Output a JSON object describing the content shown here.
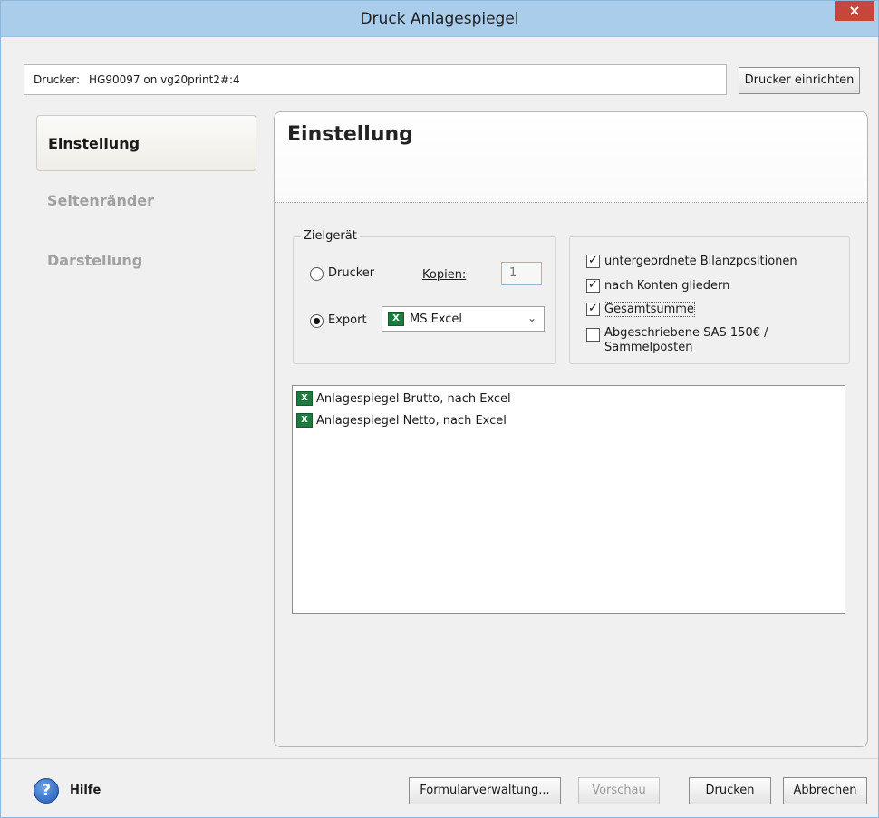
{
  "window": {
    "title": "Druck Anlagespiegel",
    "close_glyph": "×"
  },
  "printer": {
    "label": "Drucker:",
    "value": "HG90097 on vg20print2#:4",
    "setup_button": "Drucker einrichten"
  },
  "nav": {
    "items": [
      {
        "label": "Einstellung",
        "active": true
      },
      {
        "label": "Seitenränder",
        "active": false
      },
      {
        "label": "Darstellung",
        "active": false
      }
    ]
  },
  "panel": {
    "heading": "Einstellung"
  },
  "target": {
    "legend": "Zielgerät",
    "printer_option": "Drucker",
    "export_option": "Export",
    "selected": "Export",
    "copies_label": "Kopien:",
    "copies_value": "1",
    "export_format": "MS Excel",
    "export_icon": "excel-icon"
  },
  "options": [
    {
      "label": "untergeordnete Bilanzpositionen",
      "checked": true
    },
    {
      "label": "nach Konten gliedern",
      "checked": true
    },
    {
      "label": "Gesamtsumme",
      "checked": true
    },
    {
      "label_line1": "Abgeschriebene SAS 150€ /",
      "label_line2": "Sammelposten",
      "checked": false
    }
  ],
  "reports": [
    {
      "label": "Anlagespiegel Brutto, nach Excel",
      "icon": "excel-icon"
    },
    {
      "label": "Anlagespiegel Netto, nach Excel",
      "icon": "excel-icon"
    }
  ],
  "footer": {
    "help_label": "Hilfe",
    "help_icon": "help-icon",
    "forms_button": "Formularverwaltung...",
    "preview_button": "Vorschau",
    "print_button": "Drucken",
    "cancel_button": "Abbrechen"
  },
  "colors": {
    "titlebar": "#a9cdeb",
    "close": "#c7463b",
    "excel": "#1f7a3f",
    "help": "#1d56b3"
  }
}
